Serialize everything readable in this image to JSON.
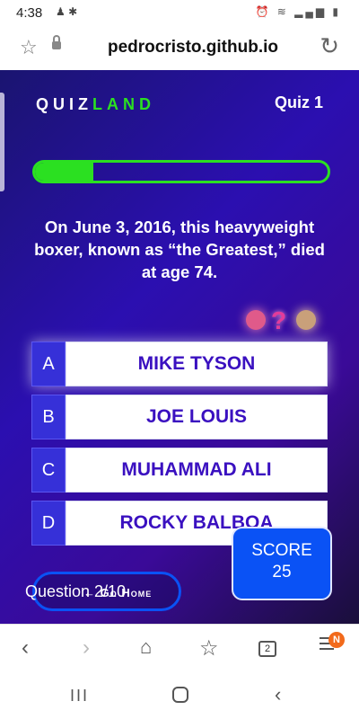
{
  "status_bar": {
    "time": "4:38",
    "left_icons": "♟ ✱",
    "right_icons": "⏰ ≋ ▂▄▆ ▮"
  },
  "browser": {
    "url": "pedrocristo.github.io",
    "bookmark_icon": "☆",
    "reload_icon": "↻"
  },
  "quiz": {
    "logo_quiz": "QUIZ",
    "logo_land": "LAND",
    "quiz_label": "Quiz 1",
    "progress_fraction": 0.2,
    "question": "On June 3, 2016, this heavyweight boxer, known as “the Greatest,” died at age 74.",
    "question_mark": "?",
    "answers": [
      {
        "letter": "A",
        "text": "MIKE TYSON"
      },
      {
        "letter": "B",
        "text": "JOE LOUIS"
      },
      {
        "letter": "C",
        "text": "MUHAMMAD ALI"
      },
      {
        "letter": "D",
        "text": "ROCKY BALBOA"
      }
    ],
    "score_label": "SCORE",
    "score_value": "25",
    "go_home_label": "Go Home",
    "go_home_icon": "←",
    "counter": "Question 2/10"
  },
  "bottom_nav": {
    "back_icon": "‹",
    "forward_icon": "›",
    "home_icon": "⌂",
    "bookmarks_icon": "☆",
    "tabs_count": "2",
    "badge": "N"
  },
  "system_nav": {
    "recents_icon": "III",
    "back_icon": "‹"
  },
  "colors": {
    "accent_green": "#2be021",
    "brand_blue": "#0a52f5",
    "answer_text": "#3a10c0"
  }
}
